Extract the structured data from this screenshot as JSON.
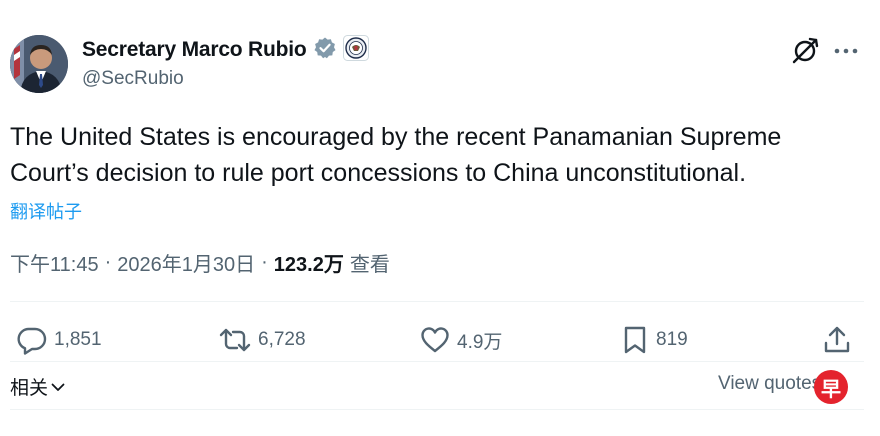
{
  "author": {
    "name": "Secretary Marco Rubio",
    "handle": "@SecRubio",
    "verified_color": "#829aab"
  },
  "post": {
    "text": "The United States is encouraged by the recent Panamanian Supreme Court’s decision to rule port concessions to China unconstitutional.",
    "translate_label": "翻译帖子",
    "time": "下午11:45",
    "separator": "·",
    "date": "2026年1月30日",
    "views": "123.2万",
    "views_label": "查看"
  },
  "actions": {
    "replies": "1,851",
    "reposts": "6,728",
    "likes": "4.9万",
    "bookmarks": "819"
  },
  "footer": {
    "related_label": "相关",
    "view_quotes_label": "View quotes",
    "watermark_char": "早"
  },
  "icons": [
    "verified-badge-icon",
    "state-department-seal-icon",
    "grok-icon",
    "more-icon",
    "reply-icon",
    "repost-icon",
    "like-icon",
    "bookmark-icon",
    "share-icon",
    "chevron-down-icon",
    "chevron-right-icon"
  ],
  "colors": {
    "accent": "#1d9bf0",
    "muted": "#536471",
    "text": "#0f1419",
    "divider": "#eff3f4",
    "watermark": "#e4232d"
  }
}
